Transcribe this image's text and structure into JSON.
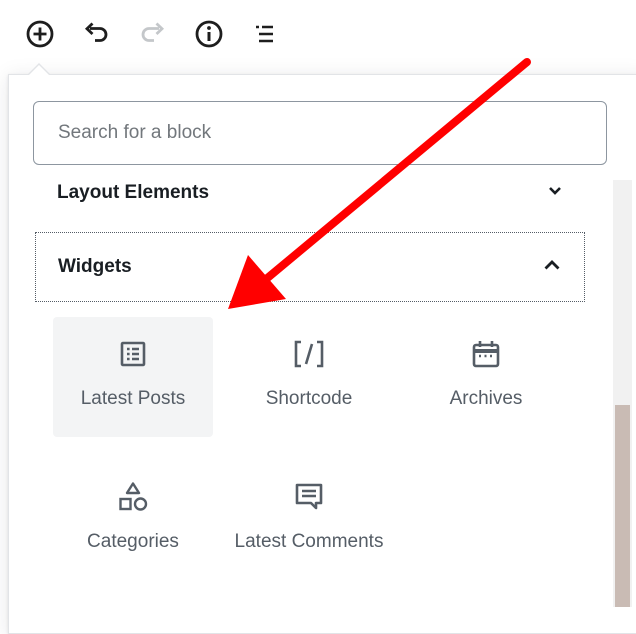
{
  "colors": {
    "accent_arrow": "#ff0000",
    "icon": "#555d66",
    "toolbar_icon": "#1e1e1e",
    "redo_disabled": "#c4c7ca",
    "hover_bg": "#f3f4f5",
    "scroll_thumb": "#c9bbb4"
  },
  "toolbar": {
    "items": [
      {
        "name": "add-block",
        "icon": "plus-circle-icon"
      },
      {
        "name": "undo",
        "icon": "undo-icon"
      },
      {
        "name": "redo",
        "icon": "redo-icon",
        "disabled": true
      },
      {
        "name": "info",
        "icon": "info-icon"
      },
      {
        "name": "block-navigation",
        "icon": "list-icon"
      }
    ]
  },
  "search": {
    "placeholder": "Search for a block",
    "value": ""
  },
  "sections": [
    {
      "title": "Layout Elements",
      "expanded": false,
      "icon": "chevron-down-icon"
    },
    {
      "title": "Widgets",
      "expanded": true,
      "icon": "chevron-up-icon"
    }
  ],
  "widgets": [
    {
      "label": "Latest Posts",
      "icon": "post-list-icon",
      "hovered": true
    },
    {
      "label": "Shortcode",
      "icon": "shortcode-icon"
    },
    {
      "label": "Archives",
      "icon": "calendar-icon"
    },
    {
      "label": "Categories",
      "icon": "shapes-icon"
    },
    {
      "label": "Latest Comments",
      "icon": "comment-icon"
    }
  ]
}
